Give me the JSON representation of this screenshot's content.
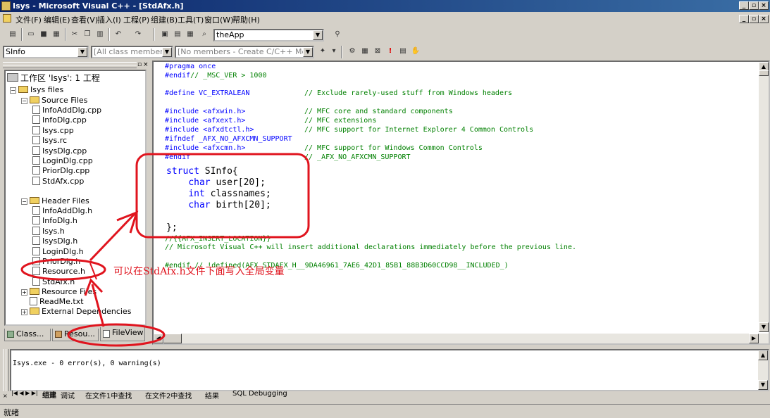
{
  "window": {
    "title": "Isys - Microsoft Visual C++ - [StdAfx.h]"
  },
  "menu": [
    "文件(F)",
    "编辑(E)",
    "查看(V)",
    "插入(I)",
    "工程(P)",
    "组建(B)",
    "工具(T)",
    "窗口(W)",
    "帮助(H)"
  ],
  "toolbar": {
    "class_combo": "theApp"
  },
  "wizardbar": {
    "class": "SInfo",
    "filter": "[All class members]",
    "members": "[No members - Create C/C++ Member"
  },
  "workspace": {
    "title": "工作区 'Isys': 1 工程",
    "project": "Isys files",
    "source_folder": "Source Files",
    "source_files": [
      "InfoAddDlg.cpp",
      "InfoDlg.cpp",
      "Isys.cpp",
      "Isys.rc",
      "IsysDlg.cpp",
      "LoginDlg.cpp",
      "PriorDlg.cpp",
      "StdAfx.cpp"
    ],
    "header_folder": "Header Files",
    "header_files": [
      "InfoAddDlg.h",
      "InfoDlg.h",
      "Isys.h",
      "IsysDlg.h",
      "LoginDlg.h",
      "PriorDlg.h",
      "Resource.h",
      "StdAfx.h"
    ],
    "resource_folder": "Resource Files",
    "readme": "ReadMe.txt",
    "external": "External Dependencies",
    "tabs": [
      "Class...",
      "Resou...",
      "FileView"
    ]
  },
  "annotation": {
    "text": "可以在StdAfx.h文件下面写入全局变量"
  },
  "editor": {
    "lines": [
      {
        "k": "#pragma once",
        "c": ""
      },
      {
        "k": "#endif",
        "c": "// _MSC_VER > 1000"
      },
      {
        "k": "#define VC_EXTRALEAN",
        "c": "// Exclude rarely-used stuff from Windows headers"
      },
      {
        "k": "#include <afxwin.h>",
        "c": "// MFC core and standard components"
      },
      {
        "k": "#include <afxext.h>",
        "c": "// MFC extensions"
      },
      {
        "k": "#include <afxdtctl.h>",
        "c": "// MFC support for Internet Explorer 4 Common Controls"
      },
      {
        "k": "#ifndef _AFX_NO_AFXCMN_SUPPORT",
        "c": ""
      },
      {
        "k": "#include <afxcmn.h>",
        "c": "// MFC support for Windows Common Controls"
      },
      {
        "k": "#endif",
        "c": "// _AFX_NO_AFXCMN_SUPPORT"
      }
    ],
    "struct_lines": [
      "struct SInfo{",
      "    char user[20];",
      "    int classnames;",
      "    char birth[20];",
      "",
      "};"
    ],
    "after1": "//{{AFX_INSERT_LOCATION}}",
    "after2": "// Microsoft Visual C++ will insert additional declarations immediately before the previous line.",
    "after3": "#endif // !defined(AFX_STDAFX_H__9DA46961_7AE6_42D1_85B1_88B3D60CCD98__INCLUDED_)"
  },
  "output": {
    "text": "Isys.exe - 0 error(s), 0 warning(s)",
    "tabs": [
      "组建",
      "调试",
      "在文件1中查找",
      "在文件2中查找",
      "结果",
      "SQL Debugging"
    ]
  },
  "status": {
    "text": "就绪"
  },
  "colors": {
    "annotation_red": "#e0141e",
    "keyword_blue": "#0000ff",
    "comment_green": "#008000"
  }
}
